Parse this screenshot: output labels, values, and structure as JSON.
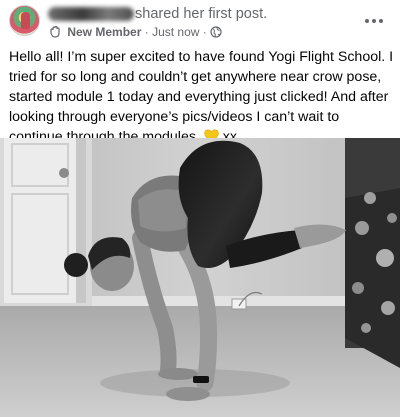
{
  "post": {
    "author_action": "shared her first post.",
    "badge": "New Member",
    "meta_separator": "·",
    "time": "Just now",
    "text_main": "Hello all! I’m super excited to have found Yogi Flight School. I tried for so long and couldn’t get anywhere near crow pose, started module 1 today and everything just clicked! And after looking through everyone’s pics/videos I can’t wait to continue through the modules.",
    "text_end": "xx"
  },
  "icons": {
    "badge": "wave-hand-icon",
    "audience": "globe-icon",
    "more": "more-dots-icon",
    "emoji": "yellow-heart-icon"
  },
  "colors": {
    "secondary_text": "#65676b",
    "primary_text": "#050505",
    "heart": "#f5c518"
  }
}
